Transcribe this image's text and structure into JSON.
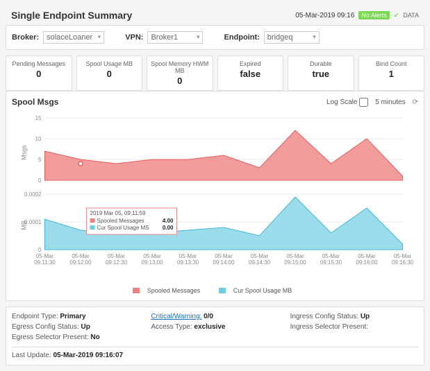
{
  "header": {
    "title": "Single Endpoint Summary",
    "timestamp": "05-Mar-2019 09:16",
    "alerts_badge": "No Alerts",
    "data_label": "DATA"
  },
  "filters": {
    "broker_label": "Broker:",
    "broker_value": "solaceLoaner",
    "vpn_label": "VPN:",
    "vpn_value": "Broker1",
    "endpoint_label": "Endpoint:",
    "endpoint_value": "bridgeq"
  },
  "stats": [
    {
      "label": "Pending Messages",
      "value": "0"
    },
    {
      "label": "Spool Usage MB",
      "value": "0"
    },
    {
      "label": "Spool Memory HWM MB",
      "value": "0"
    },
    {
      "label": "Expired",
      "value": "false"
    },
    {
      "label": "Durable",
      "value": "true"
    },
    {
      "label": "Bind Count",
      "value": "1"
    }
  ],
  "chart": {
    "title": "Spool Msgs",
    "log_scale_label": "Log Scale",
    "time_range": "5 minutes",
    "y1_label": "Msgs",
    "y2_label": "MB",
    "legend": {
      "series1": "Spooled Messages",
      "series2": "Cur Spool Usage MB"
    },
    "tooltip": {
      "time": "2019 Mar 05, 09:11:59",
      "row1_label": "Spooled Messages",
      "row1_value": "4.00",
      "row2_label": "Cur Spool Usage MS",
      "row2_value": "0.00"
    }
  },
  "chart_data": {
    "type": "area",
    "x_labels": [
      "05-Mar 09:11:30",
      "05-Mar 09:12:00",
      "05-Mar 09:12:30",
      "05-Mar 09:13:00",
      "05-Mar 09:13:30",
      "05-Mar 09:14:00",
      "05-Mar 09:14:30",
      "05-Mar 09:15:00",
      "05-Mar 09:15:30",
      "05-Mar 09:16:00",
      "05-Mar 09:16:30"
    ],
    "series": [
      {
        "name": "Spooled Messages",
        "axis": "left",
        "ylabel": "Msgs",
        "ylim": [
          0,
          15
        ],
        "yticks": [
          0,
          5,
          10,
          15
        ],
        "values": [
          7,
          5,
          4,
          5,
          5,
          6,
          3,
          12,
          4,
          10,
          1
        ]
      },
      {
        "name": "Cur Spool Usage MB",
        "axis": "left_lower",
        "ylabel": "MB",
        "ylim": [
          0,
          0.0002
        ],
        "yticks": [
          0,
          0.0001,
          0.0002
        ],
        "values": [
          0.00011,
          7e-05,
          6e-05,
          6e-05,
          7e-05,
          8e-05,
          5e-05,
          0.00019,
          6e-05,
          0.00015,
          2e-05
        ]
      }
    ],
    "title": "Spool Msgs"
  },
  "details": {
    "endpoint_type": {
      "k": "Endpoint Type:",
      "v": "Primary"
    },
    "critical_warning": {
      "k": "Critical/Warning:",
      "v": "0/0"
    },
    "ingress_config": {
      "k": "Ingress Config Status:",
      "v": "Up"
    },
    "egress_config": {
      "k": "Egress Config Status:",
      "v": "Up"
    },
    "access_type": {
      "k": "Access Type:",
      "v": "exclusive"
    },
    "ingress_selector": {
      "k": "Ingress Selector Present:",
      "v": ""
    },
    "egress_selector": {
      "k": "Egress Selector Present:",
      "v": "No"
    }
  },
  "last_update": {
    "k": "Last Update:",
    "v": "05-Mar-2019 09:16:07"
  }
}
